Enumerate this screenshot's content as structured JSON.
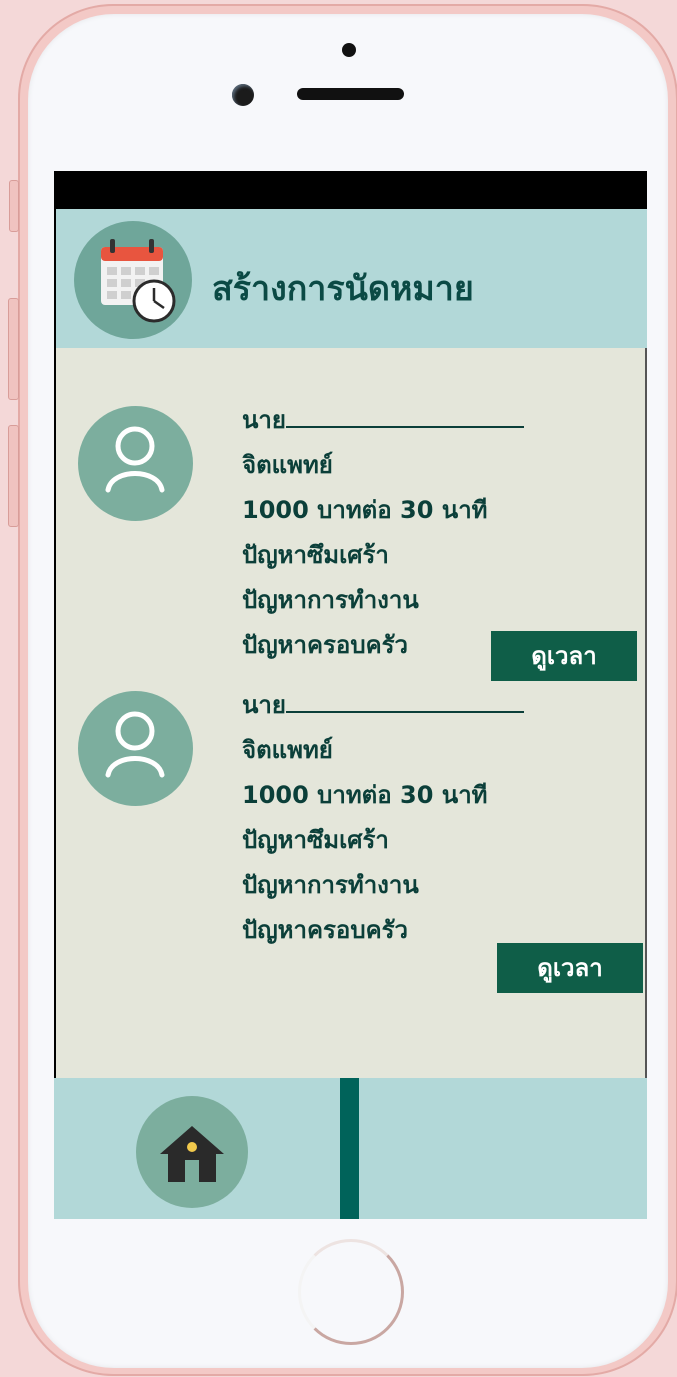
{
  "header": {
    "title": "สร้างการนัดหมาย"
  },
  "cards": [
    {
      "name_prefix": "นาย",
      "role": "จิตแพทย์",
      "price": "1000 บาทต่อ 30 นาที",
      "problem_1": "ปัญหาซึมเศร้า",
      "problem_2": "ปัญหาการทำงาน",
      "problem_3": "ปัญหาครอบครัว",
      "button_label": "ดูเวลา"
    },
    {
      "name_prefix": "นาย",
      "role": "จิตแพทย์",
      "price": "1000 บาทต่อ 30 นาที",
      "problem_1": "ปัญหาซึมเศร้า",
      "problem_2": "ปัญหาการทำงาน",
      "problem_3": "ปัญหาครอบครัว",
      "button_label": "ดูเวลา"
    }
  ],
  "icons": {
    "header": "calendar-clock-icon",
    "avatar": "user-icon",
    "nav_home": "home-icon"
  },
  "colors": {
    "header_bg": "#b2d8d8",
    "content_bg": "#e4e6da",
    "button_bg": "#0f5e48",
    "title_text": "#0b4a45",
    "accent": "#00635a"
  }
}
